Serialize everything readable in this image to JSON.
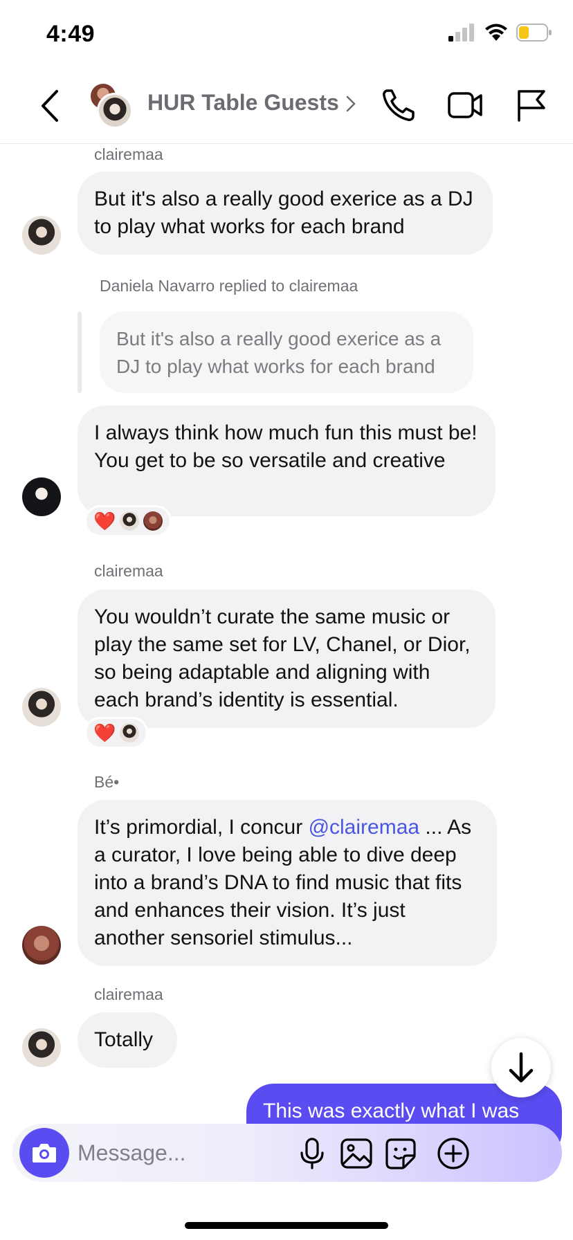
{
  "status_bar": {
    "time": "4:49"
  },
  "header": {
    "title": "HUR Table Guests"
  },
  "messages": [
    {
      "sender": "clairemaa",
      "text": "But it's also a really good exerice as a DJ to play what works for each brand"
    },
    {
      "reply_meta": "Daniela Navarro replied to clairemaa",
      "quote": "But it's also a really good exerice as a DJ to play what works for each brand",
      "text": "I always think how much fun this must be! You get to be so versatile and creative",
      "reaction": "❤️"
    },
    {
      "sender": "clairemaa",
      "text": "You wouldn’t curate the same music or play the same set for LV, Chanel, or Dior, so being adaptable and aligning with each brand’s identity is essential.",
      "reaction": "❤️"
    },
    {
      "sender": "Bé•",
      "text_before": "It’s primordial, I concur ",
      "mention": "@clairemaa",
      "text_after": " ... As a curator, I love being able to dive deep into a brand’s DNA to find music that fits and enhances their vision. It’s just another sensoriel stimulus..."
    },
    {
      "sender": "clairemaa",
      "text": "Totally"
    },
    {
      "outgoing": true,
      "text": "This was exactly what I was"
    }
  ],
  "composer": {
    "placeholder": "Message..."
  },
  "colors": {
    "accent": "#5a4cf0",
    "bubble": "#f2f2f4",
    "mention": "#4a56e2",
    "battery": "#f5c518"
  },
  "icons": [
    "back-icon",
    "chevron-right-icon",
    "phone-icon",
    "video-icon",
    "flag-icon",
    "arrow-down-icon",
    "camera-icon",
    "microphone-icon",
    "image-icon",
    "sticker-icon",
    "plus-icon"
  ]
}
